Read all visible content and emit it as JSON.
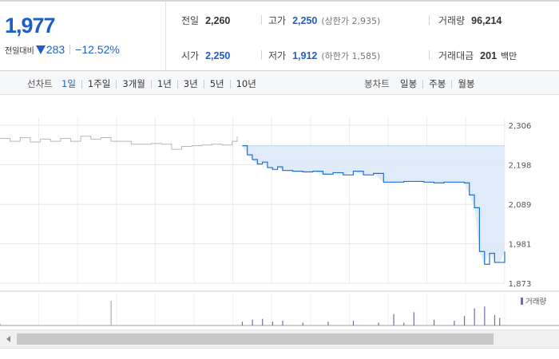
{
  "summary": {
    "price": "1,977",
    "change_label": "전일대비",
    "change_value": "283",
    "change_rate": "−12.52%",
    "prev_close_label": "전일",
    "prev_close": "2,260",
    "high_label": "고가",
    "high": "2,250",
    "upper_limit": "(상한가 2,935)",
    "volume_label": "거래량",
    "volume": "96,214",
    "open_label": "시가",
    "open": "2,250",
    "low_label": "저가",
    "low": "1,912",
    "lower_limit": "(하한가 1,585)",
    "amount_label": "거래대금",
    "amount": "201",
    "amount_unit": "백만"
  },
  "toolbar": {
    "line_chart_label": "선차트",
    "line_periods": [
      "1일",
      "1주일",
      "3개월",
      "1년",
      "3년",
      "5년",
      "10년"
    ],
    "active_period": "1일",
    "candle_label": "봉차트",
    "candle_periods": [
      "일봉",
      "주봉",
      "월봉"
    ]
  },
  "colors": {
    "accent": "#1e5ec8",
    "line_today": "#1e6fd0",
    "line_previous": "#b8b8b8",
    "area_fill": "#dde9f8",
    "volume_bar": "#7b68a8"
  },
  "icons": {
    "down_arrow": "down-triangle-icon",
    "scroll_left": "scroll-left-arrow-icon"
  },
  "chart_data": {
    "type": "line",
    "y_ticks": [
      "2,306",
      "2,198",
      "2,089",
      "1,981",
      "1,873"
    ],
    "ylim": [
      1873,
      2306
    ],
    "x_range": [
      0,
      100
    ],
    "grid": true,
    "legend": "top-right",
    "volume_label": "거래량",
    "series": [
      {
        "role": "previous",
        "x": [
          0,
          2,
          4,
          6,
          8,
          10,
          12,
          14,
          16,
          18,
          20,
          22,
          24,
          26,
          28,
          30,
          32,
          34,
          36,
          38,
          40,
          42,
          44,
          46,
          47
        ],
        "y": [
          2270,
          2262,
          2272,
          2260,
          2268,
          2262,
          2270,
          2262,
          2276,
          2268,
          2272,
          2262,
          2262,
          2254,
          2254,
          2256,
          2254,
          2240,
          2248,
          2250,
          2252,
          2254,
          2252,
          2262,
          2275
        ]
      },
      {
        "role": "today",
        "x": [
          48,
          49,
          50,
          51,
          52,
          53,
          54,
          55,
          56,
          58,
          60,
          62,
          64,
          66,
          68,
          70,
          72,
          74,
          76,
          78,
          80,
          82,
          84,
          86,
          88,
          90,
          92,
          93,
          94,
          95,
          96,
          97,
          98,
          99,
          100
        ],
        "y": [
          2250,
          2225,
          2212,
          2200,
          2205,
          2190,
          2185,
          2192,
          2182,
          2180,
          2178,
          2180,
          2172,
          2176,
          2170,
          2180,
          2170,
          2174,
          2150,
          2150,
          2152,
          2152,
          2150,
          2148,
          2150,
          2150,
          2148,
          2115,
          2080,
          1960,
          1925,
          1955,
          1930,
          1930,
          1960
        ]
      }
    ],
    "volume": {
      "x": [
        0,
        22,
        48,
        50,
        52,
        54,
        56,
        60,
        65,
        70,
        75,
        78,
        80,
        82,
        86,
        90,
        92,
        94,
        96,
        98,
        99
      ],
      "values": [
        2,
        26,
        4,
        6,
        7,
        4,
        5,
        3,
        4,
        5,
        3,
        12,
        3,
        14,
        6,
        5,
        10,
        18,
        20,
        11,
        8
      ]
    }
  }
}
